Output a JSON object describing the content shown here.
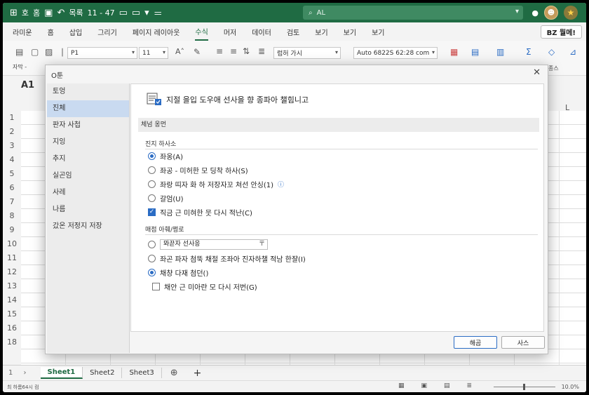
{
  "titlebar": {
    "qat": [
      "호",
      "홈",
      "보오",
      "목록",
      "11 - 47"
    ],
    "search_text": "AL"
  },
  "ribbon": {
    "tabs": [
      "라미운",
      "홈",
      "삽입",
      "그리기",
      "페이지 레이아웃",
      "수식",
      "머저",
      "데이터",
      "검토",
      "보기",
      "보기",
      "보기"
    ],
    "active_tab": "수식",
    "share_label": "BZ 뭘메!",
    "clipboard_label": "자막 -",
    "font_name": "P1",
    "font_size": "11",
    "style_box": "럼허 가시",
    "number_format": "Auto 6822S 62:28 com",
    "right_label": "종스"
  },
  "sheet": {
    "name_box": "A1",
    "col_L": "L",
    "rows": [
      "1",
      "2",
      "3",
      "4",
      "5",
      "6",
      "7",
      "8",
      "9",
      "10",
      "11",
      "12",
      "13",
      "14",
      "15",
      "16",
      "18"
    ],
    "tabs": [
      "Sheet1",
      "Sheet2",
      "Sheet3"
    ],
    "active_tab": "Sheet1",
    "status_left": "최 하롬64시 컴",
    "zoom": "10.0%"
  },
  "dialog": {
    "title": "O툰",
    "close_glyph": "✕",
    "nav": [
      "토엉",
      "진체",
      "판자 사첩",
      "지잉",
      "추지",
      "실곤임",
      "사레",
      "나름",
      "갔온 저정지 저장"
    ],
    "active_nav_index": 1,
    "header_text": "지절 을입 도우애 선사을 향 종파아 챌힘니고",
    "section1_title": "체넘 옹먼",
    "section1_sub": "진지 하사소",
    "radio_group1": [
      {
        "label": "좌옹(A)",
        "checked": true
      },
      {
        "label": "좌공 - 미허한 모 딩착 하사(S)",
        "checked": false
      },
      {
        "label": "좌랑 띠자 화 하 저장자꼬 쳐선 안싱(1)",
        "checked": false
      },
      {
        "label": "갈엄(U)",
        "checked": false
      }
    ],
    "info_glyph": "ⓘ",
    "checkbox1": {
      "label": "직금 근 미혀한 뭇 다시 적난(C)",
      "checked": true
    },
    "section2_sub": "매점 아훼/쩡로",
    "select_label": "뫄끋자 선사응",
    "select_icon": "〒",
    "radio_group2": [
      {
        "label": "좌곤 파자 첨뚝 채절 조좌아 진자하챌 적남 한쟐(I)",
        "checked": false
      },
      {
        "label": "채챵 다재 첨던()",
        "checked": true
      }
    ],
    "checkbox2": {
      "label": "채안 근 미아란 모 다시 저번(G)",
      "checked": false
    },
    "ok_label": "해곰",
    "cancel_label": "사스"
  },
  "colors": {
    "accent": "#1f6b43",
    "selection": "#2b6cc4",
    "nav_active": "#c9daf0"
  }
}
